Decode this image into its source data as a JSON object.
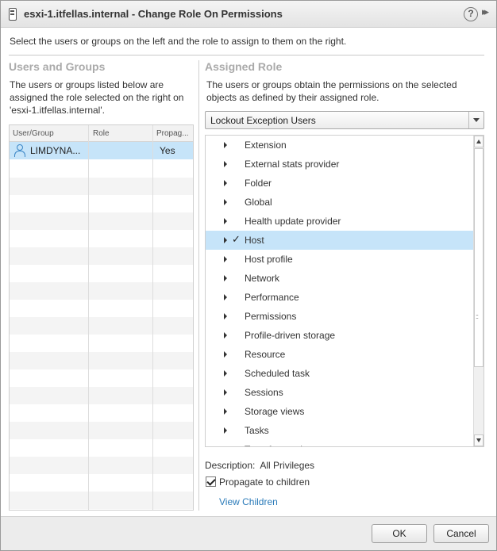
{
  "window": {
    "title": "esxi-1.itfellas.internal - Change Role On Permissions",
    "help_glyph": "?",
    "expand_glyph": "▸▸"
  },
  "intro": "Select the users or groups on the left and the role to assign to them on the right.",
  "users_and_groups": {
    "title": "Users and Groups",
    "description_lines": [
      "The users or groups listed below are",
      "assigned the role selected on the right on",
      "'esxi-1.itfellas.internal'."
    ],
    "columns": [
      "User/Group",
      "Role",
      "Propag..."
    ],
    "rows": [
      {
        "user": "LIMDYNA...",
        "role": "",
        "propagate": "Yes"
      }
    ]
  },
  "assigned_role": {
    "title": "Assigned Role",
    "description_lines": [
      "The users or groups obtain the permissions on the selected",
      "objects as defined by their assigned role."
    ],
    "selected_role": "Lockout Exception Users",
    "privileges": [
      {
        "label": "Extension",
        "checked": false
      },
      {
        "label": "External stats provider",
        "checked": false
      },
      {
        "label": "Folder",
        "checked": false
      },
      {
        "label": "Global",
        "checked": false
      },
      {
        "label": "Health update provider",
        "checked": false
      },
      {
        "label": "Host",
        "checked": true
      },
      {
        "label": "Host profile",
        "checked": false
      },
      {
        "label": "Network",
        "checked": false
      },
      {
        "label": "Performance",
        "checked": false
      },
      {
        "label": "Permissions",
        "checked": false
      },
      {
        "label": "Profile-driven storage",
        "checked": false
      },
      {
        "label": "Resource",
        "checked": false
      },
      {
        "label": "Scheduled task",
        "checked": false
      },
      {
        "label": "Sessions",
        "checked": false
      },
      {
        "label": "Storage views",
        "checked": false
      },
      {
        "label": "Tasks",
        "checked": false
      },
      {
        "label": "Transfer service",
        "checked": false
      }
    ],
    "check_glyph": "✓",
    "description_label": "Description:",
    "description_value": "All Privileges",
    "propagate_label": "Propagate to children",
    "propagate_checked": true,
    "view_children_label": "View Children"
  },
  "buttons": {
    "ok": "OK",
    "cancel": "Cancel"
  },
  "colors": {
    "selection": "#c6e4f9",
    "link": "#2b7bb9",
    "section_title": "#aaaaaa"
  }
}
